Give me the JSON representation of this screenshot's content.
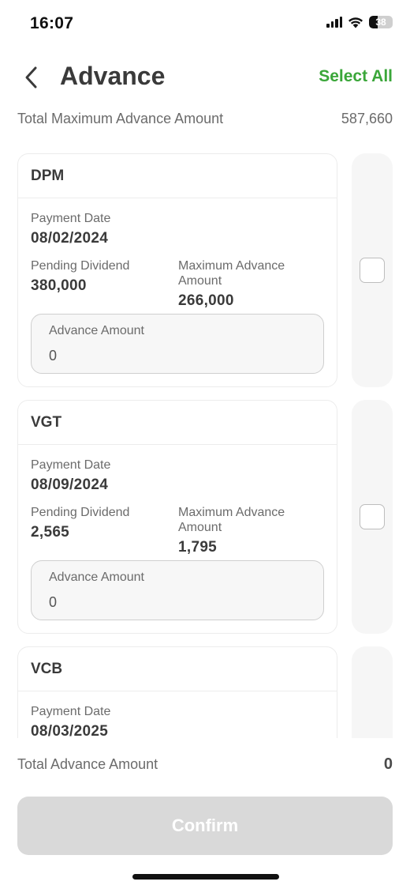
{
  "status_bar": {
    "time": "16:07",
    "battery": "38",
    "battery_level": 0.38
  },
  "header": {
    "title": "Advance",
    "select_all": "Select All"
  },
  "summary": {
    "label": "Total Maximum Advance Amount",
    "value": "587,660"
  },
  "labels": {
    "payment_date": "Payment Date",
    "pending_dividend": "Pending Dividend",
    "max_advance": "Maximum Advance Amount",
    "advance_amount": "Advance Amount"
  },
  "items": [
    {
      "ticker": "DPM",
      "payment_date": "08/02/2024",
      "pending_dividend": "380,000",
      "max_advance": "266,000",
      "advance_amount": "0",
      "checked": false
    },
    {
      "ticker": "VGT",
      "payment_date": "08/09/2024",
      "pending_dividend": "2,565",
      "max_advance": "1,795",
      "advance_amount": "0",
      "checked": false
    },
    {
      "ticker": "VCB",
      "payment_date": "08/03/2025"
    }
  ],
  "footer": {
    "total_label": "Total Advance Amount",
    "total_value": "0",
    "confirm": "Confirm"
  },
  "colors": {
    "accent": "#3aa639",
    "disabled_button": "#d9d9d9",
    "text_dark": "#3a3a3a",
    "text_muted": "#6b6b6b"
  },
  "icons": [
    "back-chevron-icon",
    "signal-icon",
    "wifi-icon",
    "battery-icon",
    "checkbox-icon"
  ]
}
